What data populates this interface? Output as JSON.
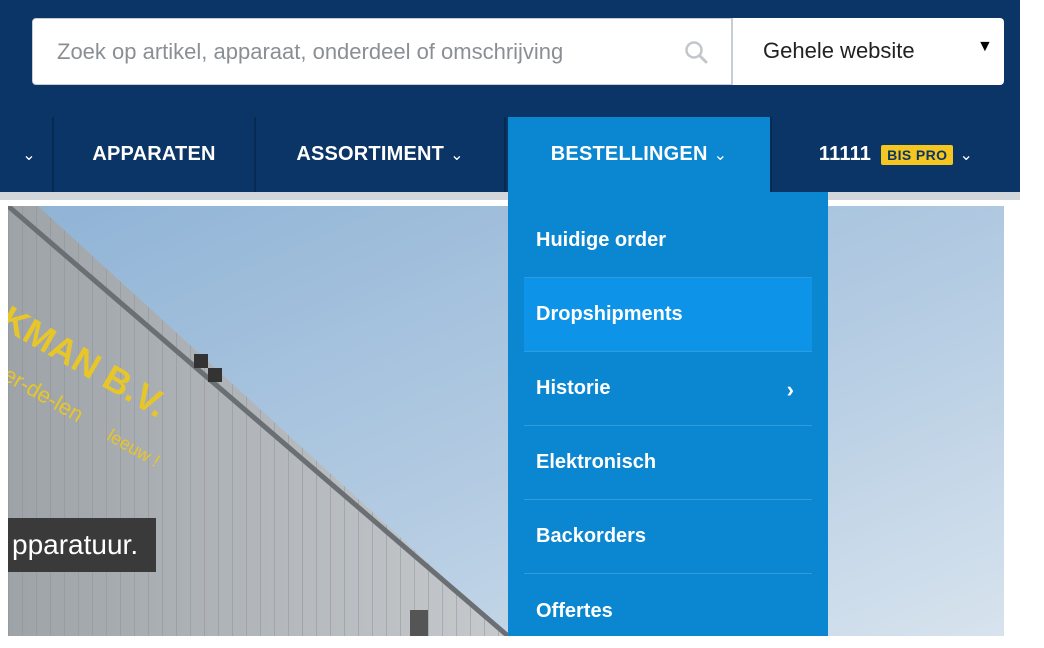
{
  "search": {
    "placeholder": "Zoek op artikel, apparaat, onderdeel of omschrijving",
    "scope_value": "Gehele website"
  },
  "nav": {
    "items": [
      {
        "label": "",
        "chevron": "⌄"
      },
      {
        "label": "APPARATEN"
      },
      {
        "label": "ASSORTIMENT",
        "chevron": "⌄"
      },
      {
        "label": "BESTELLINGEN",
        "chevron": "⌄"
      },
      {
        "label": "11111",
        "badge": "BIS PRO",
        "chevron": "⌄"
      }
    ]
  },
  "dropdown": {
    "items": [
      {
        "label": "Huidige order"
      },
      {
        "label": "Dropshipments"
      },
      {
        "label": "Historie",
        "arrow": "›"
      },
      {
        "label": "Elektronisch"
      },
      {
        "label": "Backorders"
      },
      {
        "label": "Offertes"
      }
    ]
  },
  "hero": {
    "caption": "pparatuur.",
    "sign_line1": "KMAN B.V.",
    "sign_line2": "-der-de-len",
    "sign_line3": "leeuw !"
  },
  "colors": {
    "header_bg": "#0b3566",
    "active_tab": "#0b86d1",
    "badge": "#f4c61f"
  }
}
